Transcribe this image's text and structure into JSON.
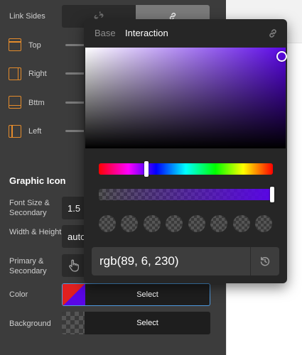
{
  "panel": {
    "link_sides": {
      "label": "Link Sides",
      "options": [
        "unlink-icon",
        "link-icon"
      ],
      "active": "link-icon"
    },
    "sides": [
      {
        "label": "Top",
        "icon": "border-top-icon"
      },
      {
        "label": "Right",
        "icon": "border-right-icon"
      },
      {
        "label": "Bttm",
        "icon": "border-bottom-icon"
      },
      {
        "label": "Left",
        "icon": "border-left-icon"
      }
    ],
    "graphic_icon": {
      "title": "Graphic Icon",
      "font_size_label": "Font Size & Secondary",
      "font_size_value": "1.5",
      "width_height_label": "Width & Height",
      "width_height_value": "auto",
      "primary_secondary_label": "Primary & Secondary",
      "primary_secondary_icon": "pointer-hand-icon",
      "color_label": "Color",
      "color_select_label": "Select",
      "background_label": "Background",
      "background_select_label": "Select"
    }
  },
  "picker": {
    "tabs": [
      {
        "label": "Base",
        "active": false
      },
      {
        "label": "Interaction",
        "active": true
      }
    ],
    "link_icon": "link-icon",
    "value": "rgb(89, 6, 230)",
    "reset_icon": "reset-icon",
    "colors": {
      "current": "#5906e6",
      "accent": "#e38b2c",
      "focus": "#4d9ae0"
    },
    "presets_count_visible": 8
  }
}
